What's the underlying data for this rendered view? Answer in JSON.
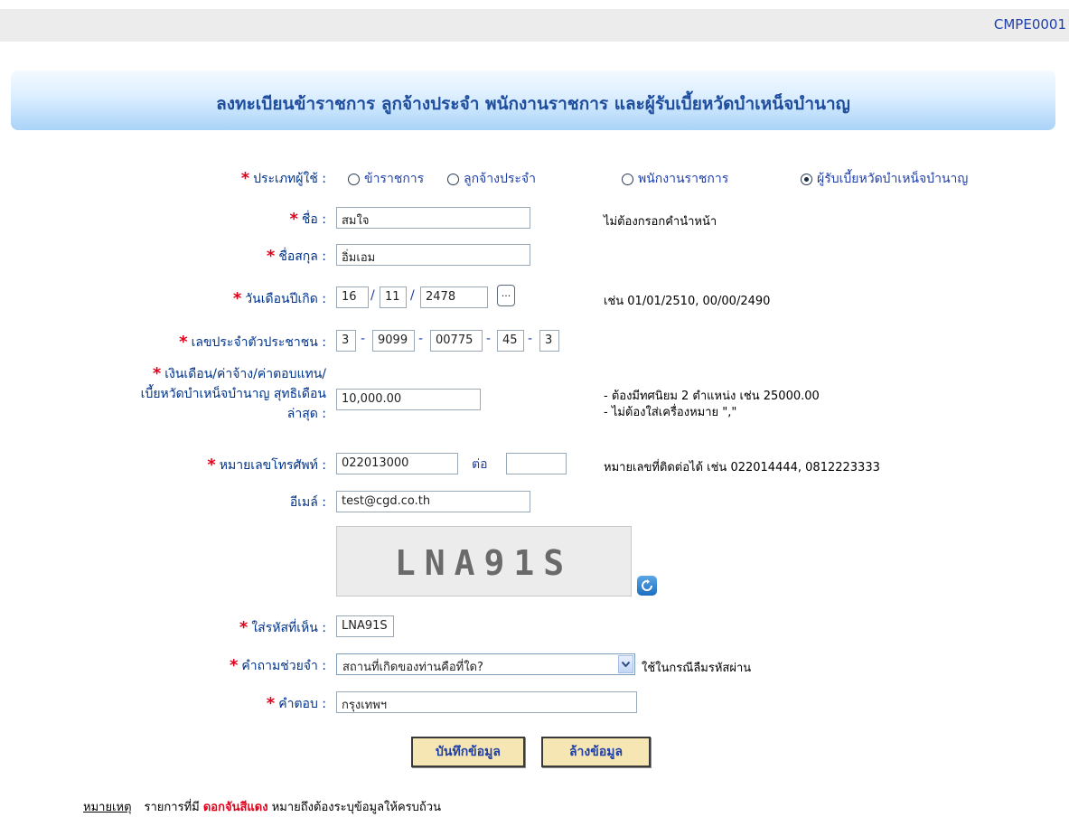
{
  "page_code": "CMPE0001",
  "title": "ลงทะเบียนข้าราชการ ลูกจ้างประจำ พนักงานราชการ และผู้รับเบี้ยหวัดบำเหน็จบำนาญ",
  "colors": {
    "required_star": "#e3001b",
    "label": "#00338a",
    "button_bg": "#f6e6b3"
  },
  "user_type": {
    "label": "ประเภทผู้ใช้ :",
    "options": [
      "ข้าราชการ",
      "ลูกจ้างประจำ",
      "พนักงานราชการ",
      "ผู้รับเบี้ยหวัดบำเหน็จบำนาญ"
    ],
    "selected": "ผู้รับเบี้ยหวัดบำเหน็จบำนาญ"
  },
  "first_name": {
    "label": "ชื่อ :",
    "value": "สมใจ",
    "hint": "ไม่ต้องกรอกคำนำหน้า"
  },
  "last_name": {
    "label": "ชื่อสกุล :",
    "value": "อิ่มเอม"
  },
  "birth_date": {
    "label": "วันเดือนปีเกิด :",
    "day": "16",
    "month": "11",
    "year": "2478",
    "calendar_button": "...",
    "hint": "เช่น 01/01/2510,  00/00/2490"
  },
  "citizen_id": {
    "label": "เลขประจำตัวประชาชน :",
    "parts": [
      "3",
      "9099",
      "00775",
      "45",
      "3"
    ]
  },
  "salary": {
    "label_lines": [
      "เงินเดือน/ค่าจ้าง/ค่าตอบแทน/",
      "เบี้ยหวัดบำเหน็จบำนาญ สุทธิเดือน",
      "ล่าสุด :"
    ],
    "value": "10,000.00",
    "hints": [
      "- ต้องมีทศนิยม 2 ตำแหน่ง เช่น 25000.00",
      "- ไม่ต้องใส่เครื่องหมาย \",\""
    ]
  },
  "phone": {
    "label": "หมายเลขโทรศัพท์ :",
    "value": "022013000",
    "ext_label": "ต่อ",
    "ext_value": "",
    "hint": "หมายเลขที่ติดต่อได้ เช่น 022014444,  0812223333"
  },
  "email": {
    "label": "อีเมล์ :",
    "value": "test@cgd.co.th"
  },
  "captcha": {
    "text": "LNA91S",
    "refresh_icon": "refresh-icon"
  },
  "captcha_input": {
    "label": "ใส่รหัสที่เห็น :",
    "value": "LNA91S"
  },
  "security_question": {
    "label": "คำถามช่วยจำ :",
    "value": "สถานที่เกิดของท่านคือที่ใด?",
    "hint": "ใช้ในกรณีลืมรหัสผ่าน"
  },
  "answer": {
    "label": "คำตอบ :",
    "value": "กรุงเทพฯ"
  },
  "buttons": {
    "save": "บันทึกข้อมูล",
    "clear": "ล้างข้อมูล"
  },
  "note": {
    "title": "หมายเหตุ",
    "text1": "รายการที่มี",
    "highlight": "ดอกจันสีแดง",
    "text2": "หมายถึงต้องระบุข้อมูลให้ครบถ้วน"
  }
}
